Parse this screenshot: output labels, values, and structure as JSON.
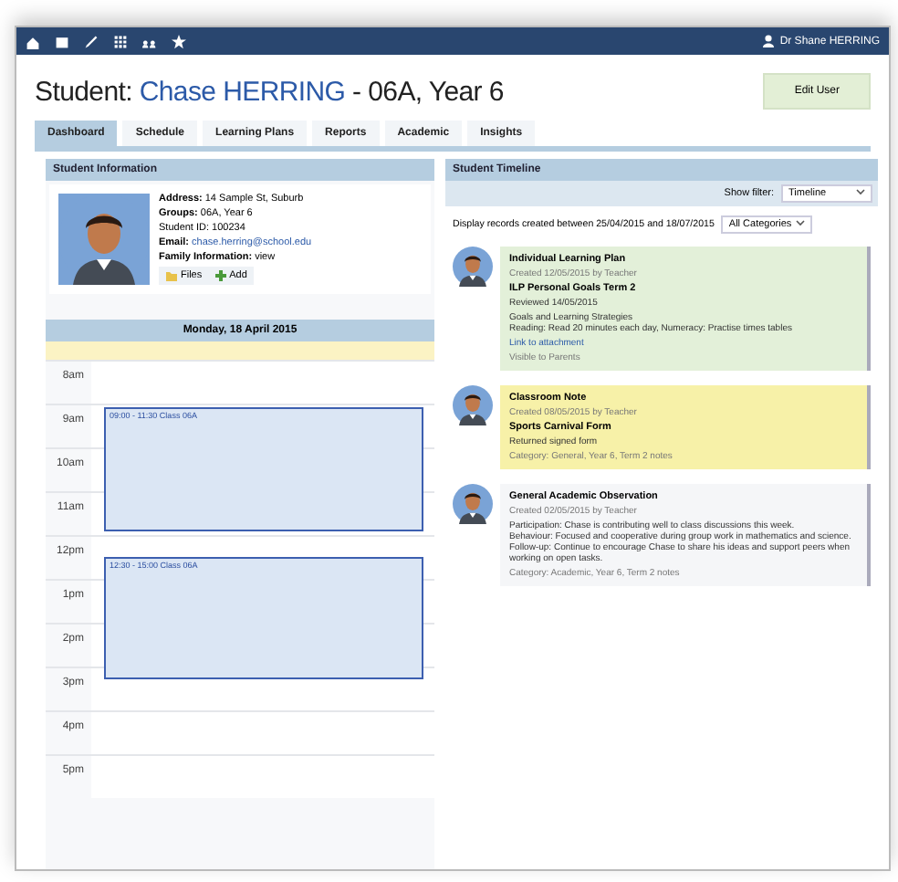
{
  "navbar": {
    "icons": [
      {
        "kind": "home"
      },
      {
        "kind": "report"
      },
      {
        "kind": "edit"
      },
      {
        "kind": "grid"
      },
      {
        "kind": "people"
      },
      {
        "kind": "star"
      }
    ],
    "user": "Dr Shane HERRING"
  },
  "header": {
    "prefix": "Student:",
    "name": "Chase HERRING",
    "suffix": "- 06A, Year 6",
    "button": "Edit User"
  },
  "tabs": [
    {
      "label": "Dashboard",
      "selected": true
    },
    {
      "label": "Schedule",
      "selected": false
    },
    {
      "label": "Learning Plans",
      "selected": false
    },
    {
      "label": "Reports",
      "selected": false
    },
    {
      "label": "Academic",
      "selected": false
    },
    {
      "label": "Insights",
      "selected": false
    }
  ],
  "student_panel": {
    "title": "Student Information",
    "lines": [
      {
        "kind": "text",
        "label": "Address:",
        "value": "14 Sample St, Suburb"
      },
      {
        "kind": "text",
        "label": "Groups:",
        "value": "06A, Year 6"
      },
      {
        "kind": "text",
        "value": "Student ID: 100234"
      },
      {
        "kind": "link",
        "label": "Email:",
        "value": "chase.herring@school.edu"
      },
      {
        "kind": "text",
        "label": "Family Information:",
        "value": "view"
      }
    ],
    "actions": [
      "Files",
      "Add"
    ]
  },
  "calendar": {
    "title": "Monday, 18 April 2015",
    "hours": [
      "8am",
      "9am",
      "10am",
      "11am",
      "12pm",
      "1pm",
      "2pm",
      "3pm",
      "4pm",
      "5pm"
    ],
    "events": [
      {
        "label": "09:00 - 11:30 Class 06A"
      },
      {
        "label": "12:30 - 15:00 Class 06A"
      }
    ]
  },
  "timeline_panel": {
    "title": "Student Timeline",
    "filter_label": "Show filter:",
    "filter_value": "Timeline",
    "info": "Display records created between 25/04/2015 and 18/07/2015",
    "category": "All Categories",
    "entries": [
      {
        "color": "#e3f0d9",
        "title": "Individual Learning Plan",
        "meta": "Created 12/05/2015 by Teacher",
        "heading": "ILP Personal Goals Term 2",
        "sub": "Reviewed 14/05/2015",
        "body": "Goals and Learning Strategies\nReading: Read 20 minutes each day, Numeracy: Practise times tables",
        "link": "Link to attachment",
        "footer": "Visible to Parents"
      },
      {
        "color": "#f7f1a8",
        "title": "Classroom Note",
        "meta": "Created 08/05/2015 by Teacher",
        "heading": "Sports Carnival Form",
        "sub": "Returned signed form",
        "footer": "Category: General, Year 6, Term 2 notes"
      },
      {
        "color": "#f5f6f8",
        "title": "General Academic Observation",
        "meta": "Created 02/05/2015 by Teacher",
        "body": "Participation: Chase is contributing well to class discussions this week.\nBehaviour: Focused and cooperative during group work in mathematics and science.\nFollow-up: Continue to encourage Chase to share his ideas and support peers when working on open tasks.",
        "footer": "Category: Academic, Year 6, Term 2 notes"
      }
    ]
  }
}
